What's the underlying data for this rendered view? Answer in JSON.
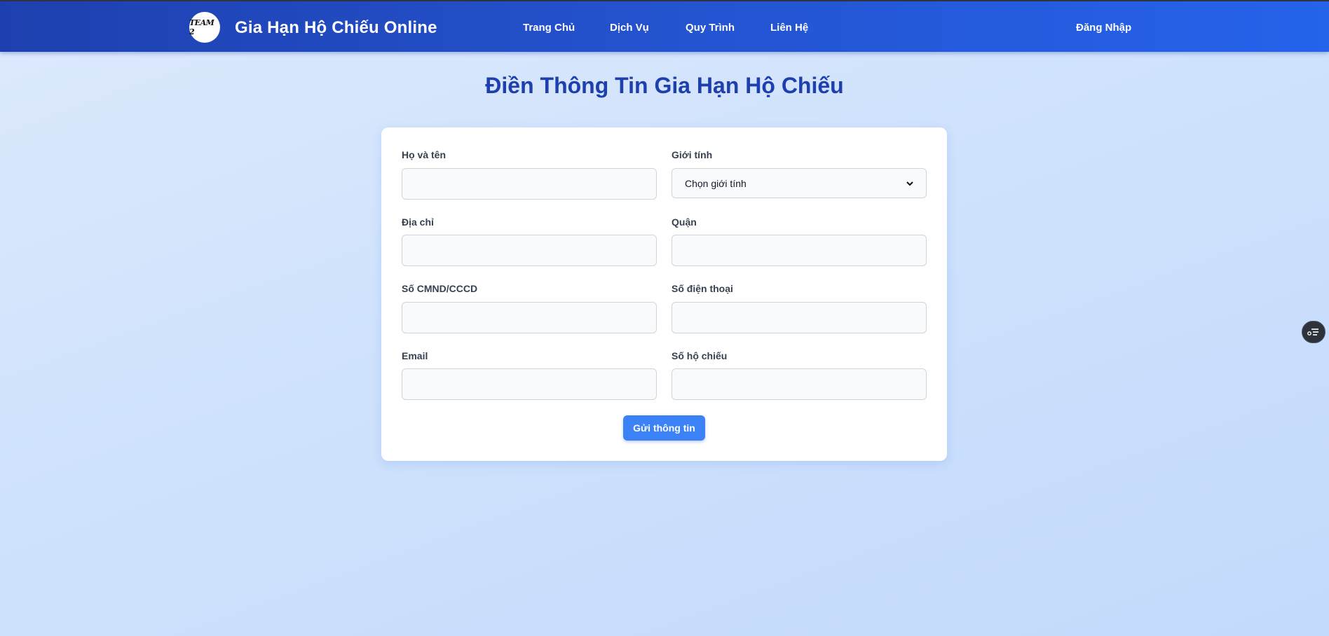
{
  "header": {
    "logo_text": "TEAM 2",
    "brand": "Gia Hạn Hộ Chiếu Online",
    "nav": [
      {
        "label": "Trang Chủ"
      },
      {
        "label": "Dịch Vụ"
      },
      {
        "label": "Quy Trình"
      },
      {
        "label": "Liên Hệ"
      }
    ],
    "login": "Đăng Nhập"
  },
  "page": {
    "title": "Điền Thông Tin Gia Hạn Hộ Chiếu"
  },
  "form": {
    "full_name": {
      "label": "Họ và tên",
      "value": ""
    },
    "gender": {
      "label": "Giới tính",
      "selected": "Chọn giới tính"
    },
    "address": {
      "label": "Địa chỉ",
      "value": ""
    },
    "district": {
      "label": "Quận",
      "value": ""
    },
    "id_number": {
      "label": "Số CMND/CCCD",
      "value": ""
    },
    "phone": {
      "label": "Số điện thoại",
      "value": ""
    },
    "email": {
      "label": "Email",
      "value": ""
    },
    "passport_number": {
      "label": "Số hộ chiếu",
      "value": ""
    },
    "submit": "Gửi thông tin"
  },
  "floating_button": {
    "icon": "list-filter-icon"
  }
}
